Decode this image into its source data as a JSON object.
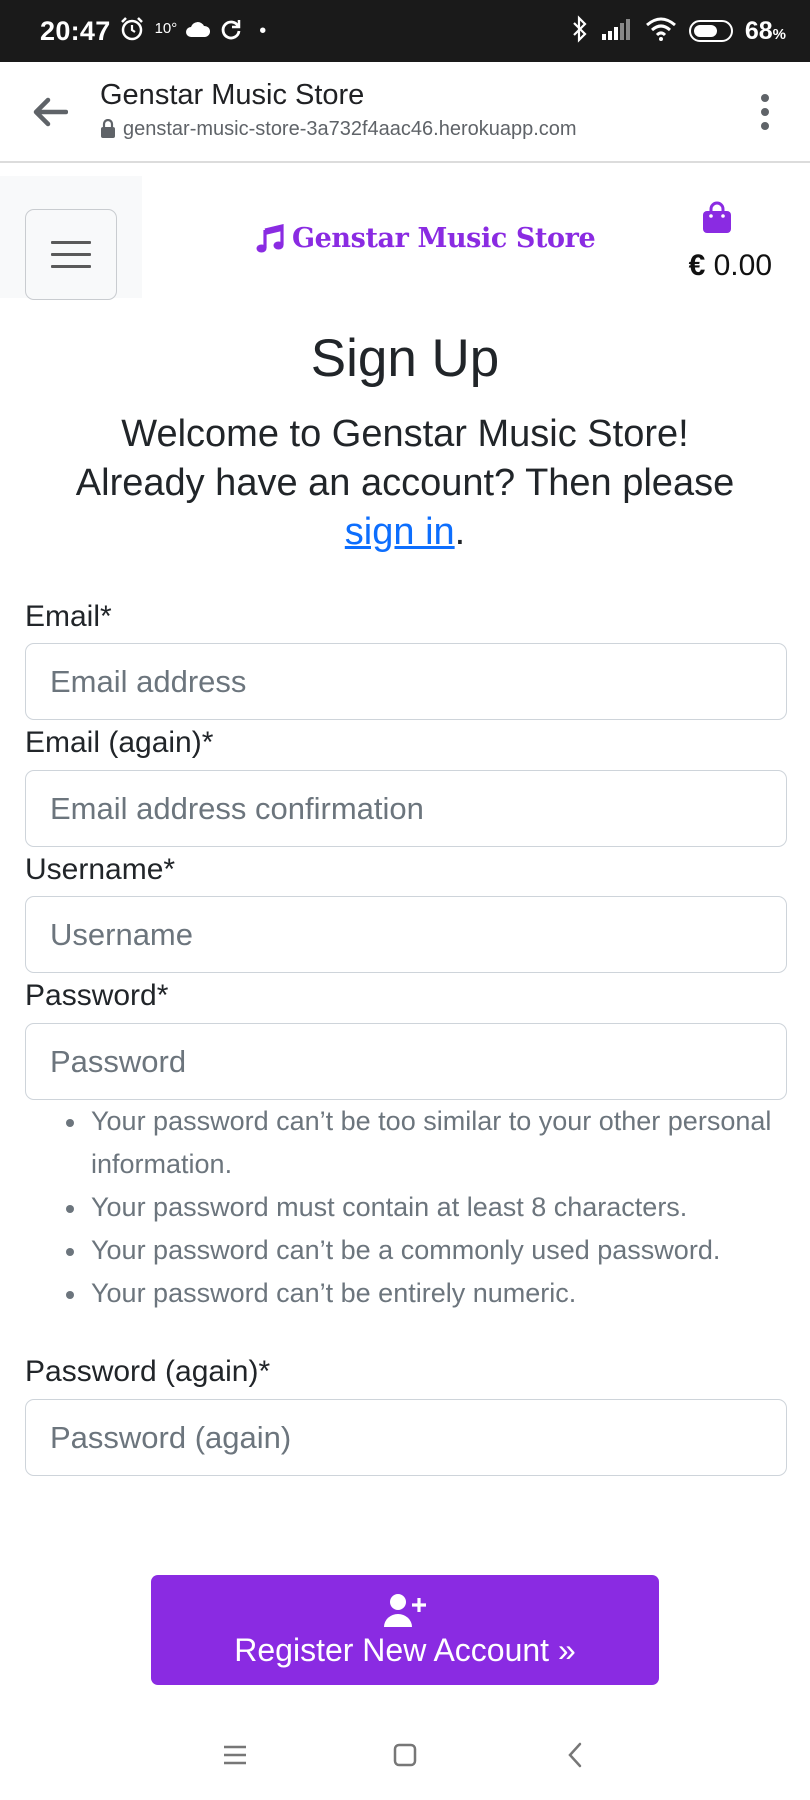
{
  "status_bar": {
    "time": "20:47",
    "temperature": "10°",
    "battery": "68",
    "battery_unit": "%",
    "battery_level": 0.68
  },
  "browser": {
    "title": "Genstar Music Store",
    "url": "genstar-music-store-3a732f4aac46.herokuapp.com"
  },
  "site_nav": {
    "brand": "Genstar Music Store",
    "cart_currency": "€",
    "cart_total": "0.00",
    "brand_color": "#8a2be2"
  },
  "signup": {
    "title": "Sign Up",
    "lead_line1": "Welcome to Genstar Music Store!",
    "lead_line2": "Already have an account? Then please",
    "signin_link": "sign in",
    "lead_end": ".",
    "fields": [
      {
        "label": "Email*",
        "placeholder": "Email address"
      },
      {
        "label": "Email (again)*",
        "placeholder": "Email address confirmation"
      },
      {
        "label": "Username*",
        "placeholder": "Username"
      },
      {
        "label": "Password*",
        "placeholder": "Password"
      },
      {
        "label": "Password (again)*",
        "placeholder": "Password (again)"
      }
    ],
    "password_help": [
      "Your password can’t be too similar to your other personal information.",
      "Your password must contain at least 8 characters.",
      "Your password can’t be a commonly used password.",
      "Your password can’t be entirely numeric."
    ],
    "submit_label": "Register New Account »",
    "submit_icon": "user-plus-icon"
  }
}
